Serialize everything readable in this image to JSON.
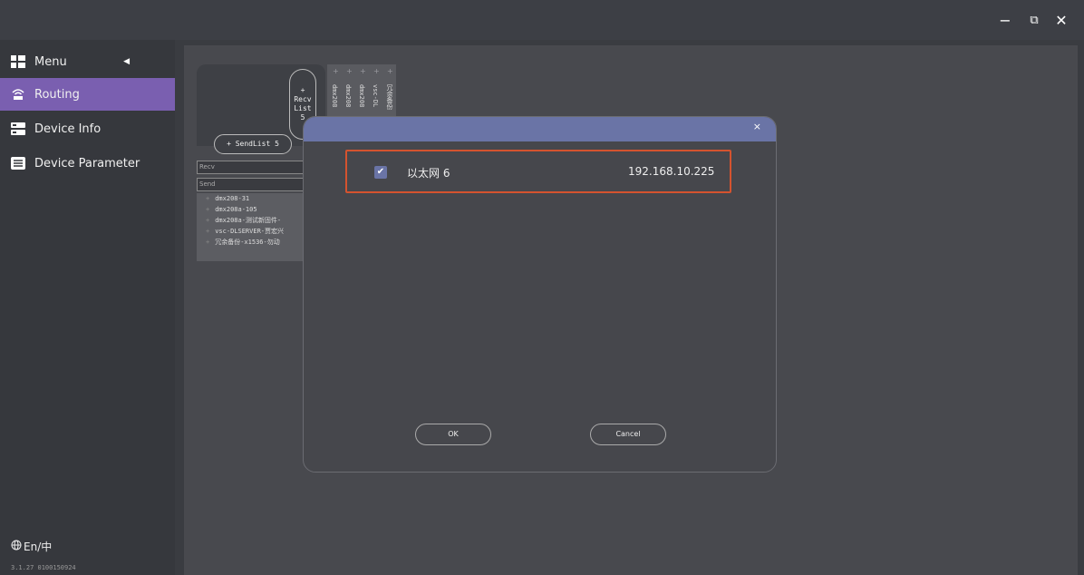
{
  "window": {
    "minimize_label": "−",
    "restore_label": "⧉",
    "close_label": "✕"
  },
  "sidebar": {
    "menu_label": "Menu",
    "items": [
      {
        "label": "Routing",
        "icon": "router-icon",
        "active": true
      },
      {
        "label": "Device Info",
        "icon": "server-icon",
        "active": false
      },
      {
        "label": "Device Parameter",
        "icon": "parameter-icon",
        "active": false
      }
    ],
    "language_label": "En/中",
    "version": "3.1.27  0100150924"
  },
  "routing": {
    "recv_list_label": [
      "+",
      "Recv",
      "List",
      "5"
    ],
    "send_list_label": "+ SendList 5",
    "recv_field": "Recv",
    "send_field": "Send",
    "columns": [
      "dmx208",
      "dmx208",
      "dmx208",
      "vsc-DL",
      "冗余备份"
    ],
    "rows": [
      "dmx208-31",
      "dmx208a-105",
      "dmx208a-测试新固件-",
      "vsc-DLSERVER-贾宏兴",
      "冗余备份-x1536-勿动"
    ]
  },
  "dialog": {
    "close_label": "×",
    "network": {
      "name": "以太网 6",
      "ip": "192.168.10.225",
      "checked": true
    },
    "ok_label": "OK",
    "cancel_label": "Cancel"
  },
  "colors": {
    "accent_purple": "#7a5fb0",
    "dialog_header": "#6a74a6",
    "highlight_red": "#d4532f"
  }
}
